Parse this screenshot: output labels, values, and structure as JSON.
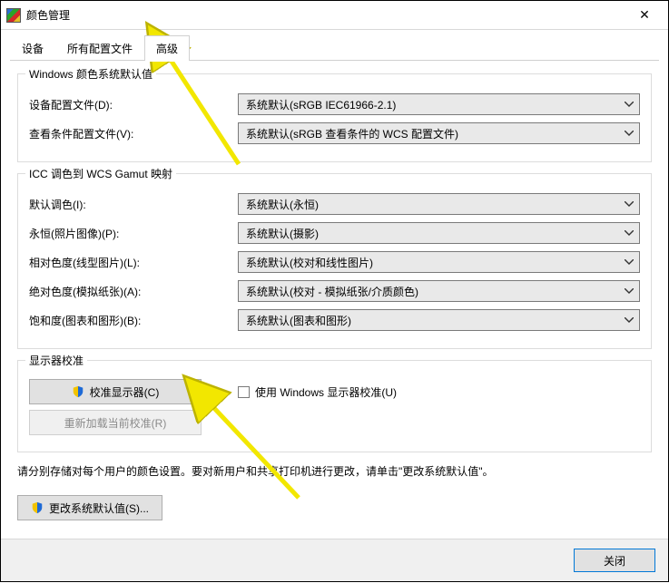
{
  "window": {
    "title": "颜色管理",
    "close_glyph": "✕"
  },
  "tabs": [
    {
      "label": "设备"
    },
    {
      "label": "所有配置文件"
    },
    {
      "label": "高级",
      "active": true
    }
  ],
  "group_defaults": {
    "title": "Windows 颜色系统默认值",
    "rows": [
      {
        "label": "设备配置文件(D):",
        "value": "系统默认(sRGB IEC61966-2.1)"
      },
      {
        "label": "查看条件配置文件(V):",
        "value": "系统默认(sRGB 查看条件的 WCS 配置文件)"
      }
    ]
  },
  "group_icc": {
    "title": "ICC 调色到 WCS Gamut 映射",
    "rows": [
      {
        "label": "默认调色(I):",
        "value": "系统默认(永恒)"
      },
      {
        "label": "永恒(照片图像)(P):",
        "value": "系统默认(摄影)"
      },
      {
        "label": "相对色度(线型图片)(L):",
        "value": "系统默认(校对和线性图片)"
      },
      {
        "label": "绝对色度(模拟纸张)(A):",
        "value": "系统默认(校对 - 模拟纸张/介质颜色)"
      },
      {
        "label": "饱和度(图表和图形)(B):",
        "value": "系统默认(图表和图形)"
      }
    ]
  },
  "group_calib": {
    "title": "显示器校准",
    "calibrate_button": "校准显示器(C)",
    "reload_button": "重新加载当前校准(R)",
    "use_windows_calib": "使用 Windows 显示器校准(U)"
  },
  "note_text": "请分别存储对每个用户的颜色设置。要对新用户和共享打印机进行更改，请单击\"更改系统默认值\"。",
  "change_defaults_button": "更改系统默认值(S)...",
  "footer": {
    "close": "关闭"
  }
}
